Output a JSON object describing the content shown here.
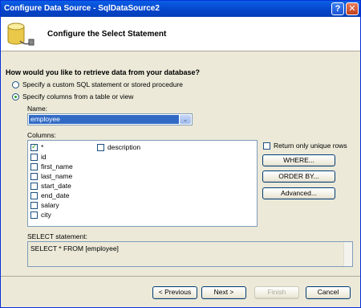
{
  "window": {
    "title": "Configure Data Source - SqlDataSource2",
    "help_glyph": "?",
    "close_glyph": "✕"
  },
  "header": {
    "title": "Configure the Select Statement",
    "icon": "database-icon"
  },
  "question": "How would you like to retrieve data from your database?",
  "options": {
    "custom_sql": "Specify a custom SQL statement or stored procedure",
    "columns": "Specify columns from a table or view",
    "selected": "columns"
  },
  "name_field": {
    "label": "Name:",
    "value": "employee",
    "arrow": "⌄"
  },
  "columns": {
    "label": "Columns:",
    "items": [
      {
        "label": "*",
        "checked": true
      },
      {
        "label": "id",
        "checked": false
      },
      {
        "label": "first_name",
        "checked": false
      },
      {
        "label": "last_name",
        "checked": false
      },
      {
        "label": "start_date",
        "checked": false
      },
      {
        "label": "end_date",
        "checked": false
      },
      {
        "label": "salary",
        "checked": false
      },
      {
        "label": "city",
        "checked": false
      },
      {
        "label": "description",
        "checked": false
      }
    ]
  },
  "unique_rows": {
    "label": "Return only unique rows",
    "checked": false
  },
  "side_buttons": {
    "where": "WHERE...",
    "order_by": "ORDER BY...",
    "advanced": "Advanced..."
  },
  "select_statement": {
    "label": "SELECT statement:",
    "value": "SELECT * FROM [employee]"
  },
  "footer": {
    "previous": "< Previous",
    "next": "Next >",
    "finish": "Finish",
    "cancel": "Cancel"
  }
}
